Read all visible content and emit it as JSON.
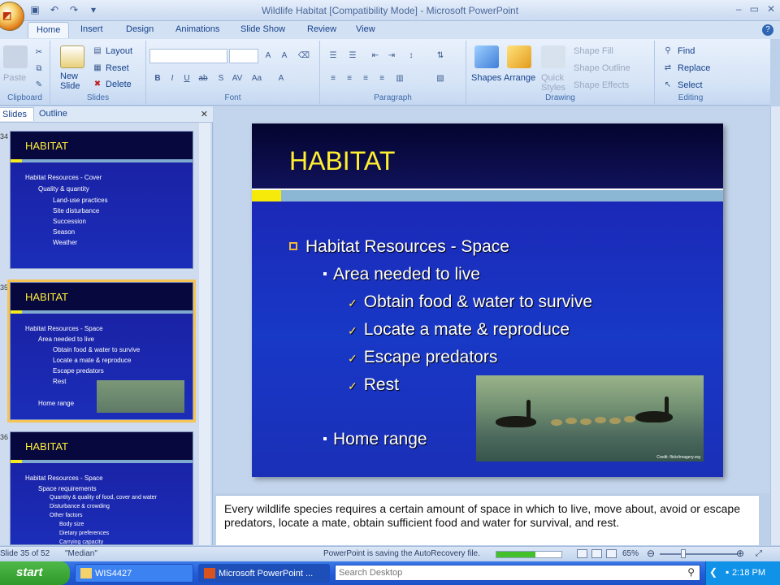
{
  "window": {
    "title": "Wildlife Habitat [Compatibility Mode] - Microsoft PowerPoint"
  },
  "tabs": [
    "Home",
    "Insert",
    "Design",
    "Animations",
    "Slide Show",
    "Review",
    "View"
  ],
  "ribbon": {
    "clipboard": {
      "label": "Clipboard",
      "paste": "Paste"
    },
    "slides": {
      "label": "Slides",
      "new_slide": "New Slide",
      "layout": "Layout",
      "reset": "Reset",
      "delete": "Delete"
    },
    "font": {
      "label": "Font"
    },
    "paragraph": {
      "label": "Paragraph"
    },
    "drawing": {
      "label": "Drawing",
      "shapes": "Shapes",
      "arrange": "Arrange",
      "quick_styles": "Quick Styles",
      "shape_fill": "Shape Fill",
      "shape_outline": "Shape Outline",
      "shape_effects": "Shape Effects"
    },
    "editing": {
      "label": "Editing",
      "find": "Find",
      "replace": "Replace",
      "select": "Select"
    }
  },
  "left_pane": {
    "tabs": [
      "Slides",
      "Outline"
    ],
    "thumbnails": [
      {
        "num": "34",
        "title": "HABITAT",
        "lines": [
          "Habitat Resources - Cover",
          "Quality & quantity",
          "Land-use practices",
          "Site disturbance",
          "Succession",
          "Season",
          "Weather"
        ]
      },
      {
        "num": "35",
        "title": "HABITAT",
        "lines": [
          "Habitat Resources - Space",
          "Area needed to live",
          "Obtain food & water to survive",
          "Locate a mate & reproduce",
          "Escape predators",
          "Rest",
          "Home range"
        ]
      },
      {
        "num": "36",
        "title": "HABITAT",
        "lines": [
          "Habitat Resources - Space",
          "Space requirements",
          "Quantity & quality of food, cover and water",
          "Disturbance & crowding",
          "Other factors",
          "Body size",
          "Dietary preferences",
          "Carrying capacity"
        ]
      }
    ]
  },
  "slide": {
    "title": "HABITAT",
    "heading": "Habitat Resources - Space",
    "sub1": "Area needed to live",
    "checks": [
      "Obtain food & water to survive",
      "Locate a mate & reproduce",
      "Escape predators",
      "Rest"
    ],
    "sub2": "Home range",
    "photo_credit": "Credit: flickr/imagery.org"
  },
  "notes": {
    "text": "Every wildlife species requires a certain amount of space in which to live, move about, avoid or escape predators, locate a mate, obtain sufficient food and water for survival, and rest."
  },
  "status": {
    "slide_info": "Slide 35 of 52",
    "theme": "\"Median\"",
    "saving": "PowerPoint is saving the AutoRecovery file.",
    "save_progress": 0.6,
    "zoom": "65%"
  },
  "taskbar": {
    "start": "start",
    "tasks": [
      "WIS4427",
      "Microsoft PowerPoint ..."
    ],
    "search_placeholder": "Search Desktop",
    "clock": "2:18 PM"
  },
  "colors": {
    "slide_title": "#ffef2f",
    "slide_bg": "#1838c6",
    "accent_bar": "#8bb6d4"
  }
}
